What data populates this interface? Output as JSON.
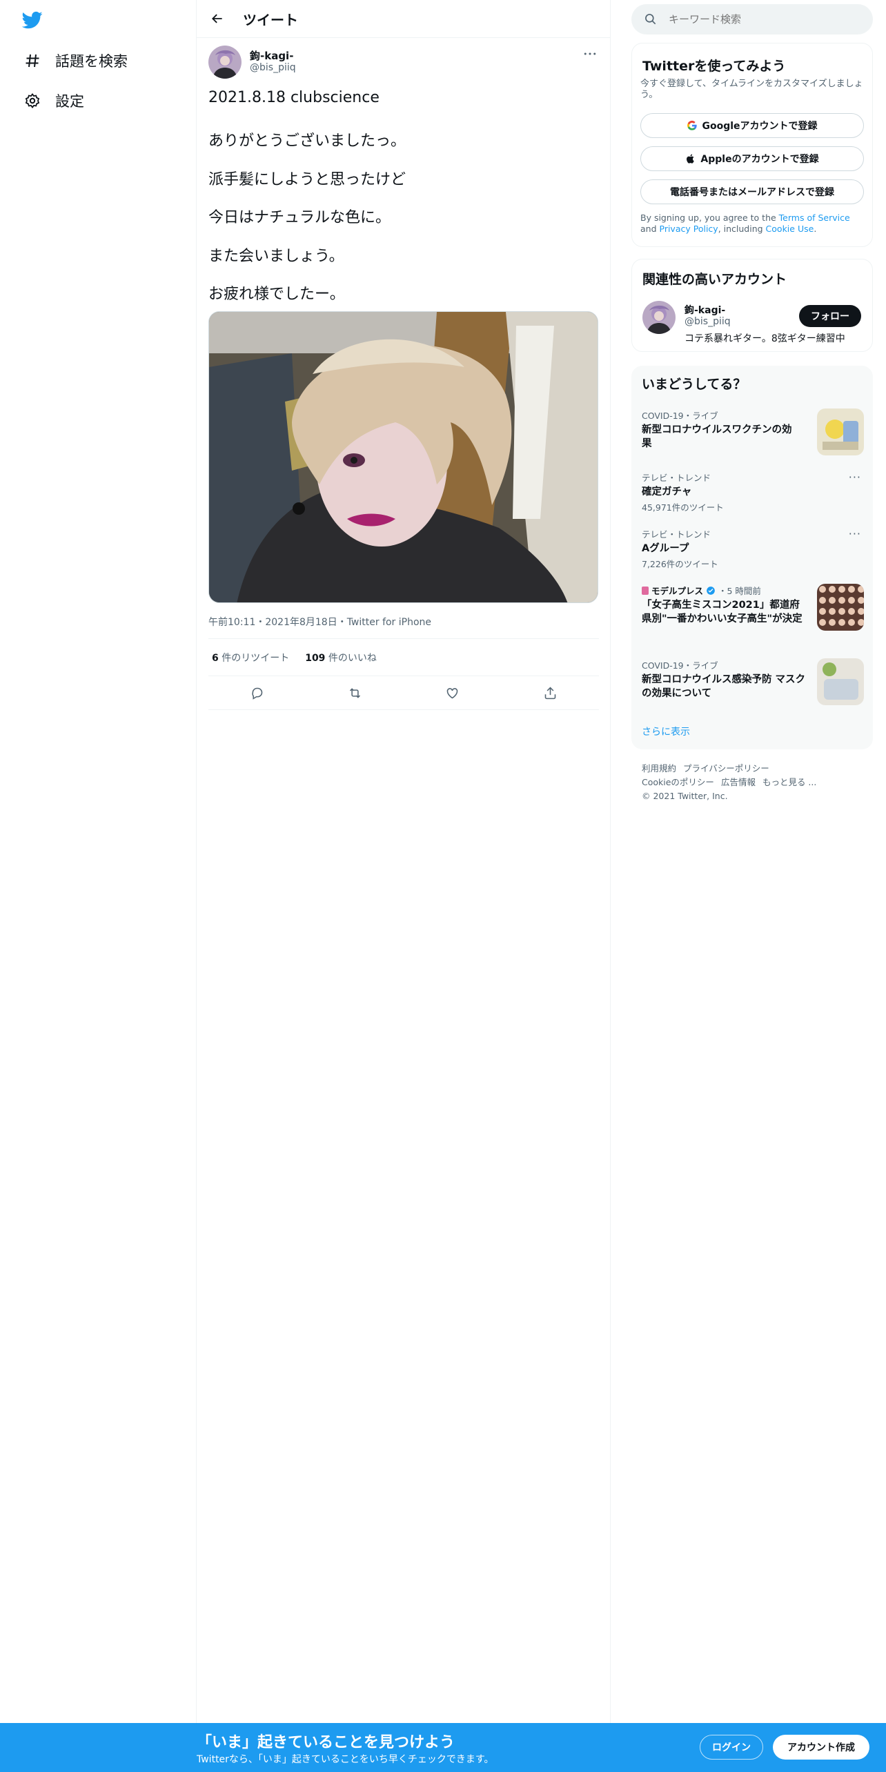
{
  "colors": {
    "accent": "#1d9bf0",
    "text": "#0f1419",
    "muted": "#536471"
  },
  "sidebar": {
    "items": [
      {
        "icon": "hashtag-icon",
        "label": "話題を検索"
      },
      {
        "icon": "gear-icon",
        "label": "設定"
      }
    ]
  },
  "header": {
    "title": "ツイート"
  },
  "tweet": {
    "display_name": "鉤-kagi-",
    "handle": "@bis_piiq",
    "lines": [
      "2021.8.18 clubscience",
      "ありがとうございましたっ。",
      "派手髪にしようと思ったけど",
      "今日はナチュラルな色に。",
      "また会いましょう。",
      "お疲れ様でしたー。"
    ],
    "meta": "午前10:11・2021年8月18日・Twitter for iPhone",
    "retweets": {
      "count": "6",
      "label": "件のリツイート"
    },
    "likes": {
      "count": "109",
      "label": "件のいいね"
    }
  },
  "search": {
    "placeholder": "キーワード検索"
  },
  "signup": {
    "title": "Twitterを使ってみよう",
    "subtitle": "今すぐ登録して、タイムラインをカスタマイズしましょう。",
    "google": "Googleアカウントで登録",
    "apple": "Appleのアカウントで登録",
    "phone": "電話番号またはメールアドレスで登録",
    "terms_pre": "By signing up, you agree to the ",
    "terms_tos": "Terms of Service",
    "terms_and": " and ",
    "terms_privacy": "Privacy Policy",
    "terms_including": ", including ",
    "terms_cookie": "Cookie Use",
    "terms_end": "."
  },
  "related": {
    "title": "関連性の高いアカウント",
    "name": "鉤-kagi-",
    "handle": "@bis_piiq",
    "bio": "コテ系暴れギター。8弦ギター練習中",
    "follow": "フォロー"
  },
  "trends": {
    "title": "いまどうしてる？",
    "items": [
      {
        "category": "COVID-19・ライブ",
        "name": "新型コロナウイルスワクチンの効果"
      },
      {
        "category": "テレビ・トレンド",
        "name": "確定ガチャ",
        "count": "45,971件のツイート"
      },
      {
        "category": "テレビ・トレンド",
        "name": "Aグループ",
        "count": "7,226件のツイート"
      },
      {
        "category": "モデルプレス",
        "time": "・5 時間前",
        "name": "「女子高生ミスコン2021」都道府県別\"一番かわいい女子高生\"が決定"
      },
      {
        "category": "COVID-19・ライブ",
        "name": "新型コロナウイルス感染予防 マスクの効果について"
      }
    ],
    "show_more": "さらに表示"
  },
  "footer": {
    "links": [
      "利用規約",
      "プライバシーポリシー",
      "Cookieのポリシー",
      "広告情報",
      "もっと見る ..."
    ],
    "copyright": "© 2021 Twitter, Inc."
  },
  "bottom_bar": {
    "title": "「いま」起きていることを見つけよう",
    "subtitle": "Twitterなら、「いま」起きていることをいち早くチェックできます。",
    "login": "ログイン",
    "signup": "アカウント作成"
  }
}
